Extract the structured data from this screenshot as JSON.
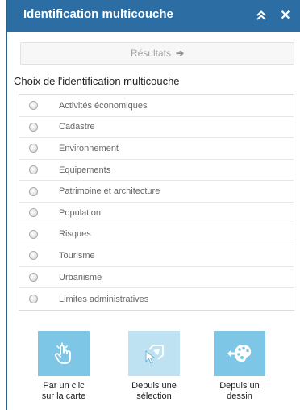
{
  "header": {
    "title": "Identification multicouche",
    "collapse_icon": "double-chevron-up-icon",
    "close_icon": "close-icon",
    "close_glyph": "✕"
  },
  "results_tab": {
    "label": "Résultats",
    "arrow": "➔"
  },
  "section_title": "Choix de l'identification multicouche",
  "layers": [
    {
      "label": "Activités économiques"
    },
    {
      "label": "Cadastre"
    },
    {
      "label": "Environnement"
    },
    {
      "label": "Equipements"
    },
    {
      "label": "Patrimoine et architecture"
    },
    {
      "label": "Population"
    },
    {
      "label": "Risques"
    },
    {
      "label": "Tourisme"
    },
    {
      "label": "Urbanisme"
    },
    {
      "label": "Limites administratives"
    }
  ],
  "actions": [
    {
      "line1": "Par un clic",
      "line2": "sur la carte",
      "icon": "hand-tap-icon"
    },
    {
      "line1": "Depuis une",
      "line2": "sélection",
      "icon": "selection-cursor-icon"
    },
    {
      "line1": "Depuis un",
      "line2": "dessin",
      "icon": "palette-icon"
    }
  ],
  "colors": {
    "header_bg": "#2c6da4",
    "action_bg": "#7dc6e6",
    "action_disabled_bg": "#bfe2f3"
  }
}
